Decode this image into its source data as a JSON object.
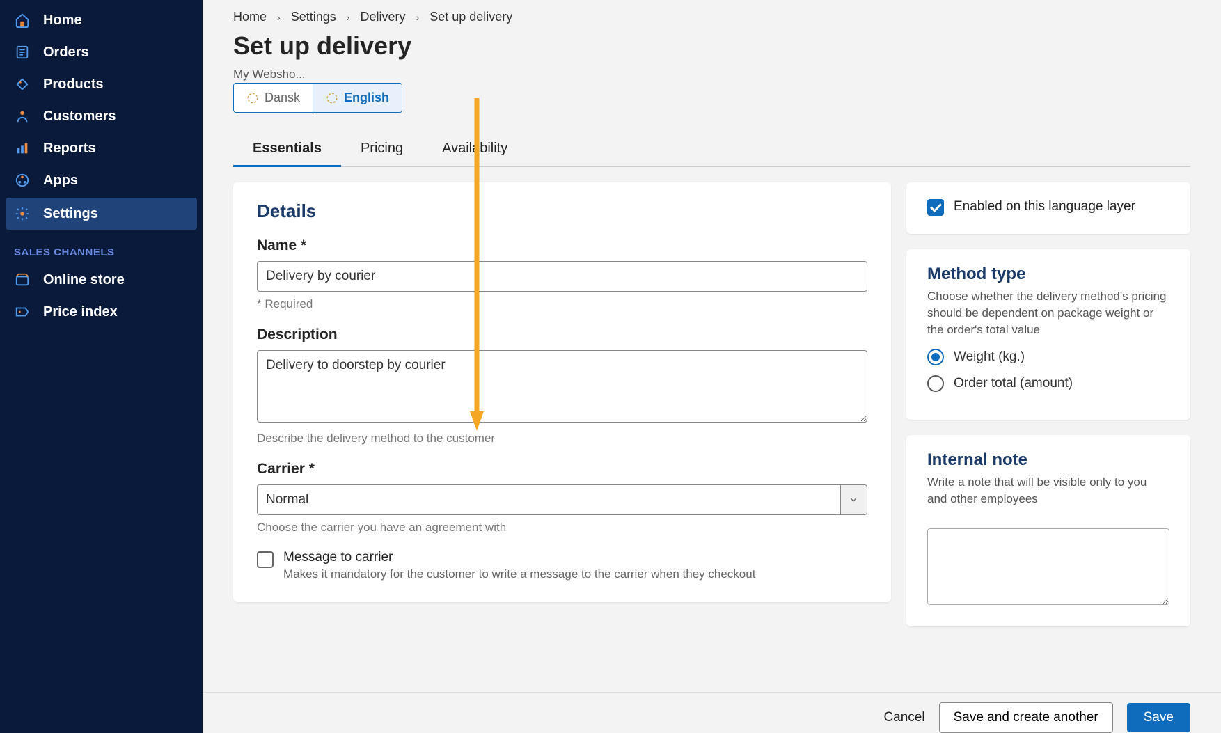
{
  "sidebar": {
    "items": [
      {
        "label": "Home"
      },
      {
        "label": "Orders"
      },
      {
        "label": "Products"
      },
      {
        "label": "Customers"
      },
      {
        "label": "Reports"
      },
      {
        "label": "Apps"
      },
      {
        "label": "Settings"
      }
    ],
    "section": "SALES CHANNELS",
    "channels": [
      {
        "label": "Online store"
      },
      {
        "label": "Price index"
      }
    ]
  },
  "breadcrumb": {
    "items": [
      {
        "label": "Home",
        "link": true
      },
      {
        "label": "Settings",
        "link": true
      },
      {
        "label": "Delivery",
        "link": true
      },
      {
        "label": "Set up delivery",
        "link": false
      }
    ]
  },
  "page": {
    "title": "Set up delivery",
    "shop": "My Websho..."
  },
  "langTabs": [
    {
      "label": "Dansk",
      "active": false
    },
    {
      "label": "English",
      "active": true
    }
  ],
  "subtabs": [
    {
      "label": "Essentials",
      "active": true
    },
    {
      "label": "Pricing",
      "active": false
    },
    {
      "label": "Availability",
      "active": false
    }
  ],
  "details": {
    "heading": "Details",
    "name_label": "Name *",
    "name_value": "Delivery by courier",
    "name_hint": "* Required",
    "desc_label": "Description",
    "desc_value": "Delivery to doorstep by courier",
    "desc_hint": "Describe the delivery method to the customer",
    "carrier_label": "Carrier *",
    "carrier_value": "Normal",
    "carrier_hint": "Choose the carrier you have an agreement with",
    "msg_label": "Message to carrier",
    "msg_desc": "Makes it mandatory for the customer to write a message to the carrier when they checkout"
  },
  "sideCards": {
    "enabled_label": "Enabled on this language layer",
    "method_title": "Method type",
    "method_desc": "Choose whether the delivery method's pricing should be dependent on package weight or the order's total value",
    "method_options": [
      {
        "label": "Weight (kg.)",
        "checked": true
      },
      {
        "label": "Order total (amount)",
        "checked": false
      }
    ],
    "note_title": "Internal note",
    "note_desc": "Write a note that will be visible only to you and other employees"
  },
  "footer": {
    "cancel": "Cancel",
    "save_another": "Save and create another",
    "save": "Save"
  }
}
